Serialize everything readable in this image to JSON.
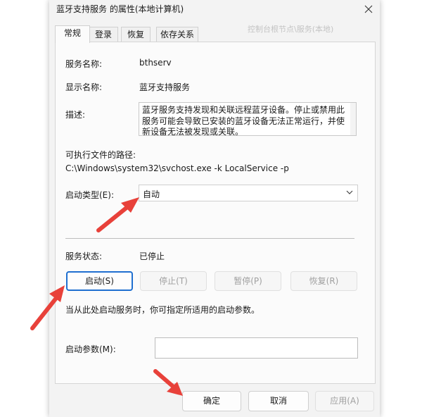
{
  "window": {
    "title": "蓝牙支持服务 的属性(本地计算机)",
    "close_icon": "close-icon"
  },
  "tabs": [
    {
      "label": "常规",
      "active": true
    },
    {
      "label": "登录",
      "active": false
    },
    {
      "label": "恢复",
      "active": false
    },
    {
      "label": "依存关系",
      "active": false
    }
  ],
  "background_hint": "控制台根节点\\服务(本地)",
  "general": {
    "service_name_label": "服务名称:",
    "service_name_value": "bthserv",
    "display_name_label": "显示名称:",
    "display_name_value": "蓝牙支持服务",
    "description_label": "描述:",
    "description_value": "蓝牙服务支持发现和关联远程蓝牙设备。停止或禁用此服务可能会导致已安装的蓝牙设备无法正常运行，并使新设备无法被发现或关联。",
    "exe_path_label": "可执行文件的路径:",
    "exe_path_value": "C:\\Windows\\system32\\svchost.exe -k LocalService -p",
    "startup_type_label": "启动类型(E):",
    "startup_type_value": "自动",
    "status_label": "服务状态:",
    "status_value": "已停止",
    "start_button": "启动(S)",
    "stop_button": "停止(T)",
    "pause_button": "暂停(P)",
    "resume_button": "恢复(R)",
    "hint_text": "当从此处启动服务时，你可指定所适用的启动参数。",
    "params_label": "启动参数(M):",
    "params_value": ""
  },
  "footer": {
    "ok_button": "确定",
    "cancel_button": "取消",
    "apply_button": "应用(A)"
  },
  "colors": {
    "annotation_arrow": "#e8413a",
    "primary_border": "#1f6fd0"
  }
}
